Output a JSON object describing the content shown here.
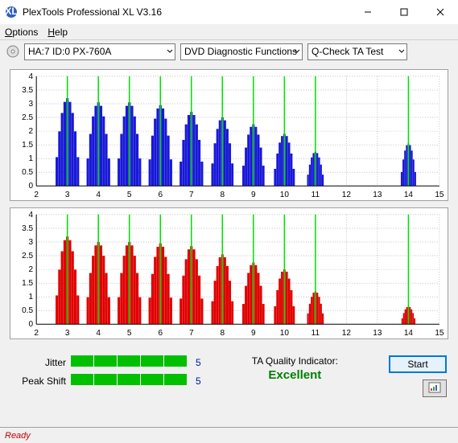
{
  "window": {
    "title": "PlexTools Professional XL V3.16"
  },
  "menu": {
    "options": "Options",
    "help": "Help"
  },
  "toolbar": {
    "device": "HA:7 ID:0   PX-760A",
    "function": "DVD Diagnostic Functions",
    "test": "Q-Check TA Test"
  },
  "chart_data": [
    {
      "type": "bar",
      "color": "#1818d8",
      "xlabel": "",
      "ylabel": "",
      "xlim": [
        2,
        15
      ],
      "ylim": [
        0,
        4
      ],
      "xticks": [
        2,
        3,
        4,
        5,
        6,
        7,
        8,
        9,
        10,
        11,
        12,
        13,
        14,
        15
      ],
      "yticks": [
        0,
        0.5,
        1,
        1.5,
        2,
        2.5,
        3,
        3.5,
        4
      ],
      "ref_lines": [
        3,
        4,
        5,
        6,
        7,
        8,
        9,
        10,
        11,
        14
      ],
      "series": [
        {
          "center": 3,
          "peak": 3.2,
          "width": 0.85
        },
        {
          "center": 4,
          "peak": 3.05,
          "width": 0.85
        },
        {
          "center": 5,
          "peak": 3.05,
          "width": 0.85
        },
        {
          "center": 6,
          "peak": 2.95,
          "width": 0.85
        },
        {
          "center": 7,
          "peak": 2.7,
          "width": 0.85
        },
        {
          "center": 8,
          "peak": 2.5,
          "width": 0.8
        },
        {
          "center": 9,
          "peak": 2.25,
          "width": 0.8
        },
        {
          "center": 10,
          "peak": 1.9,
          "width": 0.75
        },
        {
          "center": 11,
          "peak": 1.25,
          "width": 0.6
        },
        {
          "center": 14,
          "peak": 1.55,
          "width": 0.55
        }
      ]
    },
    {
      "type": "bar",
      "color": "#e00000",
      "xlabel": "",
      "ylabel": "",
      "xlim": [
        2,
        15
      ],
      "ylim": [
        0,
        4
      ],
      "xticks": [
        2,
        3,
        4,
        5,
        6,
        7,
        8,
        9,
        10,
        11,
        12,
        13,
        14,
        15
      ],
      "yticks": [
        0,
        0.5,
        1,
        1.5,
        2,
        2.5,
        3,
        3.5,
        4
      ],
      "ref_lines": [
        3,
        4,
        5,
        6,
        7,
        8,
        9,
        10,
        11,
        14
      ],
      "series": [
        {
          "center": 3,
          "peak": 3.2,
          "width": 0.85
        },
        {
          "center": 4,
          "peak": 3.0,
          "width": 0.85
        },
        {
          "center": 5,
          "peak": 3.0,
          "width": 0.85
        },
        {
          "center": 6,
          "peak": 2.95,
          "width": 0.85
        },
        {
          "center": 7,
          "peak": 2.85,
          "width": 0.85
        },
        {
          "center": 8,
          "peak": 2.55,
          "width": 0.8
        },
        {
          "center": 9,
          "peak": 2.25,
          "width": 0.8
        },
        {
          "center": 10,
          "peak": 2.0,
          "width": 0.75
        },
        {
          "center": 11,
          "peak": 1.2,
          "width": 0.6
        },
        {
          "center": 14,
          "peak": 0.65,
          "width": 0.5
        }
      ]
    }
  ],
  "metrics": {
    "jitter_label": "Jitter",
    "jitter_bars": 5,
    "jitter_val": "5",
    "peakshift_label": "Peak Shift",
    "peakshift_bars": 5,
    "peakshift_val": "5"
  },
  "quality": {
    "label": "TA Quality Indicator:",
    "value": "Excellent"
  },
  "buttons": {
    "start": "Start"
  },
  "status": {
    "text": "Ready"
  }
}
